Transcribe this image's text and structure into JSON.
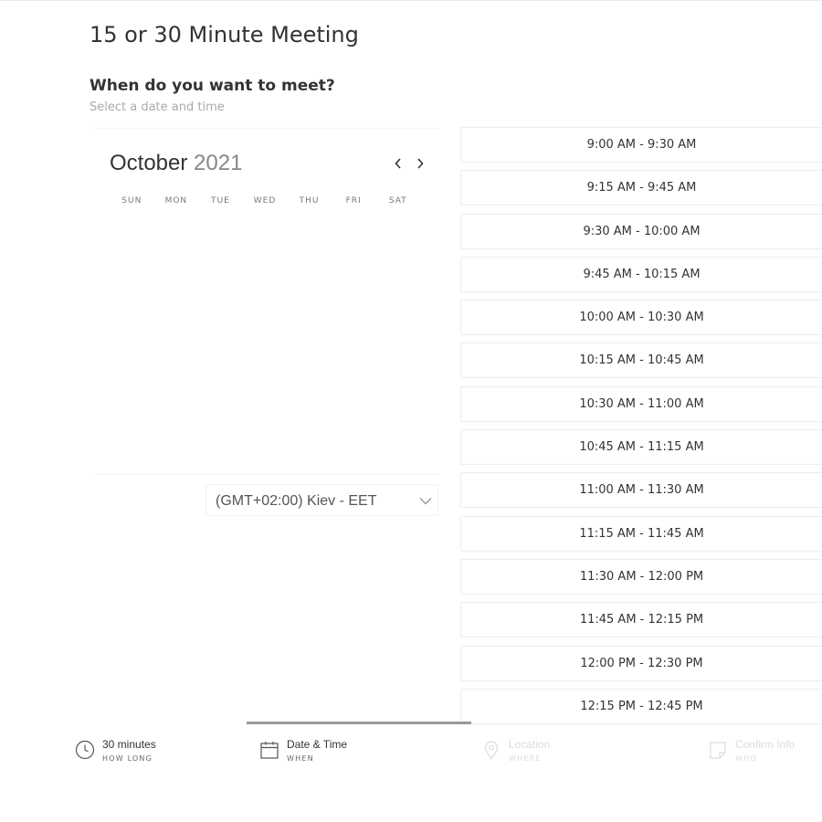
{
  "page": {
    "title": "15 or 30 Minute Meeting",
    "question": "When do you want to meet?",
    "hint": "Select a date and time"
  },
  "calendar": {
    "month": "October",
    "year": "2021",
    "weekdays": [
      "SUN",
      "MON",
      "TUE",
      "WED",
      "THU",
      "FRI",
      "SAT"
    ],
    "prev_icon": "chevron-left-icon",
    "next_icon": "chevron-right-icon"
  },
  "timezone": {
    "selected": "(GMT+02:00) Kiev - EET",
    "icon": "chevron-down-icon"
  },
  "time_slots": [
    "9:00 AM - 9:30 AM",
    "9:15 AM - 9:45 AM",
    "9:30 AM - 10:00 AM",
    "9:45 AM - 10:15 AM",
    "10:00 AM - 10:30 AM",
    "10:15 AM - 10:45 AM",
    "10:30 AM - 11:00 AM",
    "10:45 AM - 11:15 AM",
    "11:00 AM - 11:30 AM",
    "11:15 AM - 11:45 AM",
    "11:30 AM - 12:00 PM",
    "11:45 AM - 12:15 PM",
    "12:00 PM - 12:30 PM",
    "12:15 PM - 12:45 PM"
  ],
  "steps": [
    {
      "title": "30 minutes",
      "subtitle": "HOW LONG",
      "icon": "clock-icon"
    },
    {
      "title": "Date & Time",
      "subtitle": "WHEN",
      "icon": "calendar-icon"
    },
    {
      "title": "Location",
      "subtitle": "WHERE",
      "icon": "map-pin-icon"
    },
    {
      "title": "Confirm Info",
      "subtitle": "WHO",
      "icon": "note-icon"
    }
  ],
  "colors": {
    "text": "#333333",
    "muted": "#aaaaaa",
    "border": "#ededed",
    "active_step_bar": "#999999",
    "disabled_step": "#dcdcdc"
  }
}
